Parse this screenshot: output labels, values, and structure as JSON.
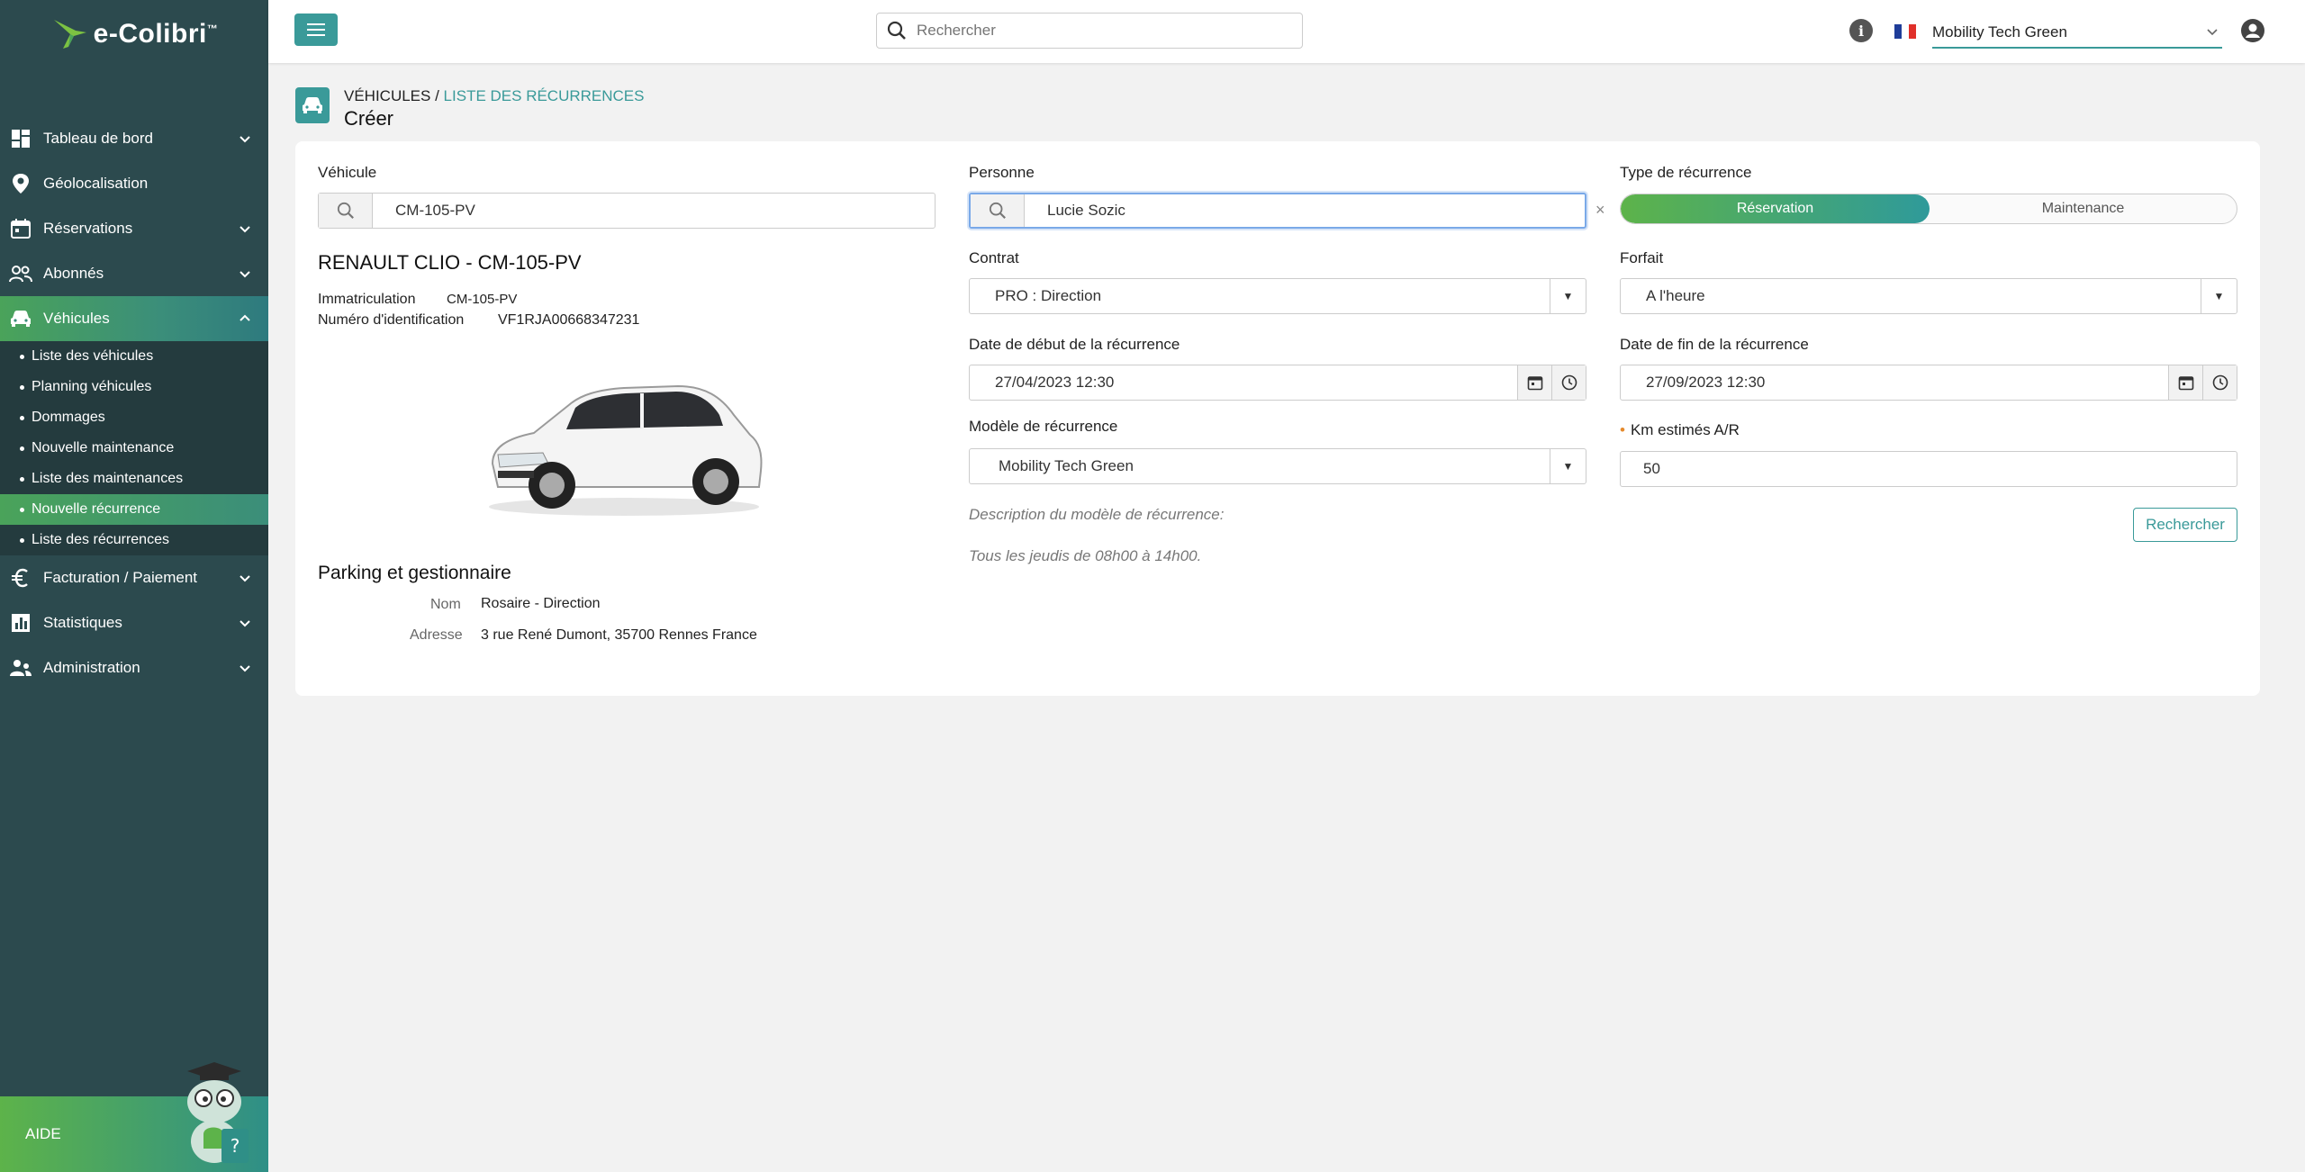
{
  "brand": {
    "name_left": "e-Co",
    "name_right": "libri",
    "tm": "™"
  },
  "colors": {
    "accent": "#3a9a99",
    "sidebar": "#2c4a4e",
    "green": "#5db34a"
  },
  "sidebar": {
    "items": [
      {
        "label": "Tableau de bord",
        "icon": "dashboard-icon"
      },
      {
        "label": "Géolocalisation",
        "icon": "location-pin-icon"
      },
      {
        "label": "Réservations",
        "icon": "calendar-icon"
      },
      {
        "label": "Abonnés",
        "icon": "users-icon"
      },
      {
        "label": "Véhicules",
        "icon": "car-icon"
      },
      {
        "label": "Facturation / Paiement",
        "icon": "euro-icon"
      },
      {
        "label": "Statistiques",
        "icon": "bar-chart-icon"
      },
      {
        "label": "Administration",
        "icon": "admin-users-icon"
      }
    ],
    "sub_items": [
      "Liste des véhicules",
      "Planning véhicules",
      "Dommages",
      "Nouvelle maintenance",
      "Liste des maintenances",
      "Nouvelle récurrence",
      "Liste des récurrences"
    ],
    "active_sub_index": 5,
    "help_label": "AIDE"
  },
  "topbar": {
    "search_placeholder": "Rechercher",
    "organization": "Mobility Tech Green"
  },
  "header": {
    "breadcrumb_parent": "VÉHICULES",
    "breadcrumb_sep": " / ",
    "breadcrumb_current": "LISTE DES RÉCURRENCES",
    "title": "Créer"
  },
  "form": {
    "vehicle_label": "Véhicule",
    "vehicle_value": "CM-105-PV",
    "vehicle_title": "RENAULT CLIO -  CM-105-PV",
    "immat_label": "Immatriculation",
    "immat_value": "CM-105-PV",
    "vin_label": "Numéro d'identification",
    "vin_value": "VF1RJA00668347231",
    "parking_title": "Parking et gestionnaire",
    "nom_label": "Nom",
    "nom_value": "Rosaire - Direction",
    "adresse_label": "Adresse",
    "adresse_value": "3 rue René Dumont, 35700 Rennes  France",
    "person_label": "Personne",
    "person_value": "Lucie Sozic",
    "clear_symbol": "×",
    "contrat_label": "Contrat",
    "contrat_value": "PRO : Direction",
    "date_start_label": "Date de début de la récurrence",
    "date_start_value": "27/04/2023 12:30",
    "model_label": "Modèle de récurrence",
    "model_value": "Mobility Tech Green",
    "model_desc_label": "Description du modèle de récurrence:",
    "model_desc_value": "Tous les jeudis de 08h00 à 14h00.",
    "type_label": "Type de récurrence",
    "type_options": [
      "Réservation",
      "Maintenance"
    ],
    "type_selected": "Réservation",
    "forfait_label": "Forfait",
    "forfait_value": "A l'heure",
    "date_end_label": "Date de fin de la récurrence",
    "date_end_value": "27/09/2023 12:30",
    "km_required_marker": "•",
    "km_label": "Km estimés A/R",
    "km_value": "50",
    "search_button": "Rechercher"
  }
}
